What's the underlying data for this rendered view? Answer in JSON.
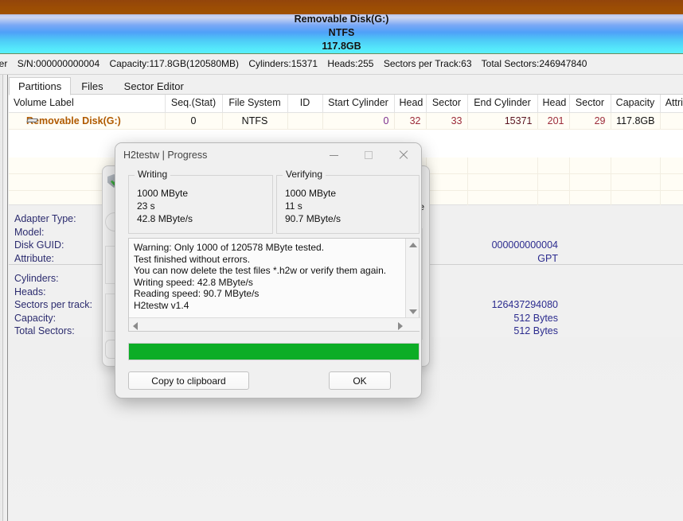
{
  "banner": {
    "line1": "Removable Disk(G:)",
    "line2": "NTFS",
    "line3": "117.8GB",
    "brown_color": "#9c4d04",
    "blue_color": "#4fa0f8"
  },
  "info_strip": {
    "controller_fragment": "ler",
    "serial": "S/N:000000000004",
    "capacity": "Capacity:117.8GB(120580MB)",
    "cylinders": "Cylinders:15371",
    "heads": "Heads:255",
    "sectors_per_track": "Sectors per Track:63",
    "total_sectors": "Total Sectors:246947840"
  },
  "tabs": [
    {
      "label": "Partitions",
      "active": true
    },
    {
      "label": "Files",
      "active": false
    },
    {
      "label": "Sector Editor",
      "active": false
    }
  ],
  "partition_table": {
    "headers": [
      "Volume Label",
      "Seq.(Stat)",
      "File System",
      "ID",
      "Start Cylinder",
      "Head",
      "Sector",
      "End Cylinder",
      "Head",
      "Sector",
      "Capacity",
      "Attribute"
    ],
    "rows": [
      {
        "volume_label": "Removable Disk(G:)",
        "seq_stat": "0",
        "file_system": "NTFS",
        "id": "",
        "start_cylinder": "0",
        "start_head": "32",
        "start_sector": "33",
        "end_cylinder": "15371",
        "end_head": "201",
        "end_sector": "29",
        "capacity": "117.8GB",
        "attribute": ""
      }
    ]
  },
  "details": {
    "group1_labels": [
      "Adapter Type:",
      "Model:",
      "Disk GUID:",
      "Attribute:"
    ],
    "group1_values": [
      "",
      "",
      "000000000004",
      "GPT"
    ],
    "group2_labels": [
      "Cylinders:",
      "Heads:",
      "Sectors per track:",
      "Capacity:",
      "Total Sectors:"
    ],
    "group2_values": [
      "",
      "",
      "126437294080",
      "512 Bytes",
      "512 Bytes"
    ]
  },
  "dialog": {
    "title": "H2testw | Progress",
    "minimize_label": "minimize",
    "maximize_label": "maximize",
    "close_label": "close",
    "writing": {
      "legend": "Writing",
      "amount": "1000 MByte",
      "time": "23 s",
      "speed": "42.8 MByte/s"
    },
    "verifying": {
      "legend": "Verifying",
      "amount": "1000 MByte",
      "time": "11 s",
      "speed": "90.7 MByte/s"
    },
    "log": "Warning: Only 1000 of 120578 MByte tested.\nTest finished without errors.\nYou can now delete the test files *.h2w or verify them again.\nWriting speed: 42.8 MByte/s\nReading speed: 90.7 MByte/s\nH2testw v1.4",
    "progress": {
      "percent": 100,
      "color": "#0cad26"
    },
    "copy_button": "Copy to clipboard",
    "ok_button": "OK"
  },
  "background_window": {
    "fragment_text": "e"
  }
}
